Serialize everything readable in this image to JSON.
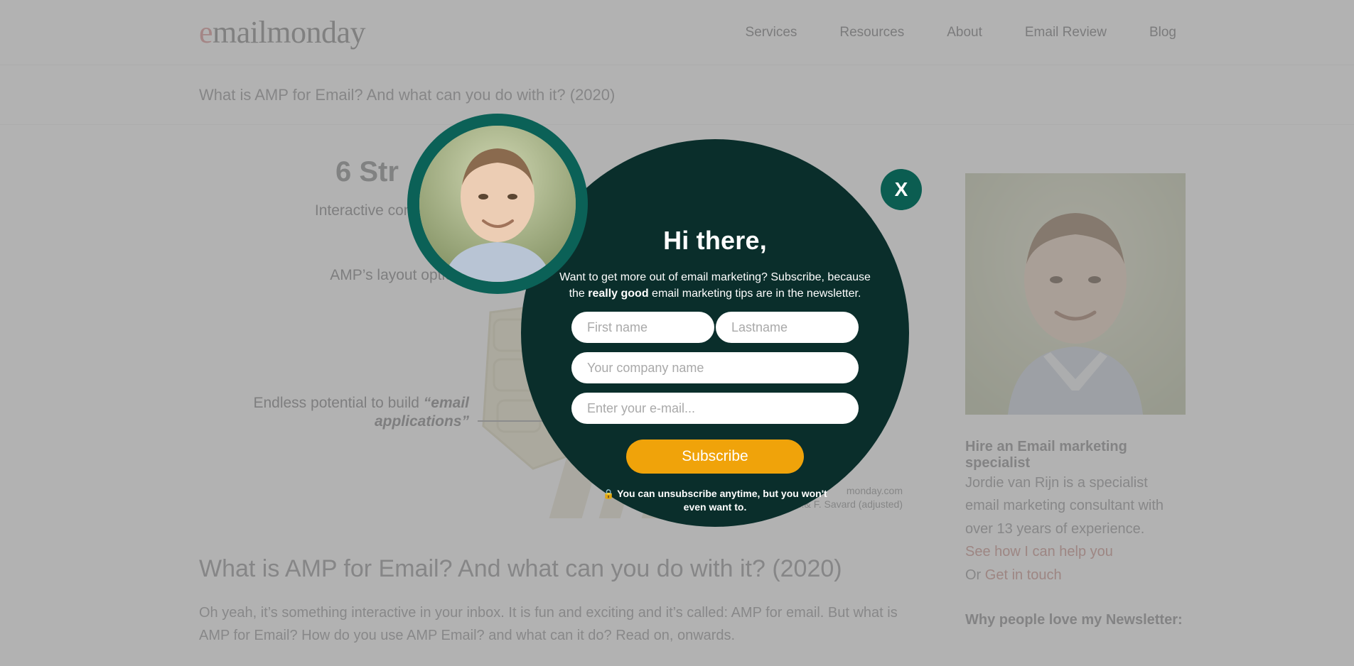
{
  "header": {
    "logo_prefix": "e",
    "logo_rest": "mailmonday",
    "nav": [
      {
        "label": "Services"
      },
      {
        "label": "Resources"
      },
      {
        "label": "About"
      },
      {
        "label": "Email Review"
      },
      {
        "label": "Blog"
      }
    ]
  },
  "breadcrumb": {
    "text": "What is AMP for Email? And what can you do with it? (2020)"
  },
  "infographic": {
    "title": "6 Str",
    "label_1": "Interactive components",
    "label_2": "AMP’s layout options",
    "label_3_pre": "Endless potential to build ",
    "label_3_em": "“email applications”",
    "credit_line_1": "monday.com",
    "credit_line_2": "(AMP conf.& F. Savard (adjusted)"
  },
  "article": {
    "title": "What is AMP for Email? And what can you do with it? (2020)",
    "body": "Oh yeah, it’s something interactive in your inbox. It is fun and exciting and it’s called: AMP for email. But what is AMP for Email? How do you use AMP Email? and what can it do? Read on, onwards."
  },
  "sidebar": {
    "heading": "Hire an Email marketing specialist",
    "text": "Jordie van Rijn is a specialist email marketing consultant with over 13 years of experience.",
    "link_help": "See how I can help you",
    "or_label": "Or ",
    "link_contact": "Get in touch",
    "heading2": "Why people love my Newsletter:"
  },
  "modal": {
    "close_label": "X",
    "close_icon": "close-icon",
    "title": "Hi there,",
    "sub_before": "Want to get more out of email marketing? Subscribe, because the ",
    "sub_bold": "really good",
    "sub_after": " email marketing tips are in the newsletter.",
    "fields": {
      "first_name_placeholder": "First name",
      "last_name_placeholder": "Lastname",
      "company_placeholder": "Your company name",
      "email_placeholder": "Enter your e-mail..."
    },
    "subscribe_label": "Subscribe",
    "lock_icon": "🔒",
    "disclaimer": "You can unsubscribe anytime, but you won't even want to."
  },
  "colors": {
    "modal_bg": "#0a2e2b",
    "accent_teal": "#0b6157",
    "close_bg": "#0b5d51",
    "subscribe_bg": "#f0a30a",
    "link_red": "#c98b84",
    "logo_red": "#d98b8b"
  }
}
